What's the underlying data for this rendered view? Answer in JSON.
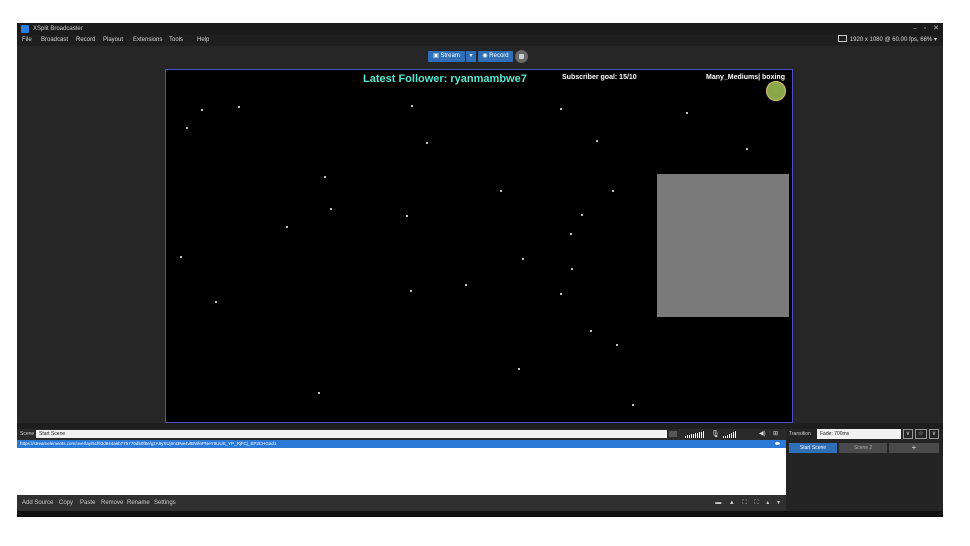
{
  "window": {
    "title": "XSplit Broadcaster",
    "controls": [
      "–",
      "▫",
      "✕"
    ]
  },
  "menu": {
    "items": [
      "File",
      "Broadcast",
      "Record",
      "Playout",
      "Extensions",
      "Tools",
      "Help"
    ],
    "resolution": "1920 x 1080 @ 60.00 fps, 66%"
  },
  "toolbar": {
    "stream_label": "Stream",
    "record_label": "Record"
  },
  "overlay": {
    "follower": "Latest Follower: ryanmambwe7",
    "subscriber": "Subscriber goal: 15/10",
    "badge": "Many_Mediums| boxing"
  },
  "scene": {
    "label": "Scene",
    "name": "Start Scene"
  },
  "sources": {
    "items": [
      "https://streamelements.com/overlay/5cf93d844a6b775770d50f8e/gzA9yXUjImI3Ne4vtBWlePNeY9UUS_YP_RjFCj_SP2CHGad1"
    ]
  },
  "source_toolbar": {
    "items": [
      "Add Source",
      "Copy",
      "Paste",
      "Remove",
      "Rename",
      "Settings"
    ]
  },
  "transition": {
    "label": "Transition",
    "value": "Fade: 700ms"
  },
  "scenes": {
    "buttons": [
      "Start Scene",
      "Scene 2",
      "+"
    ]
  },
  "colors": {
    "accent": "#2e6fb7",
    "follower_text": "#58e6d0",
    "preview_border": "#4c4cc7"
  }
}
